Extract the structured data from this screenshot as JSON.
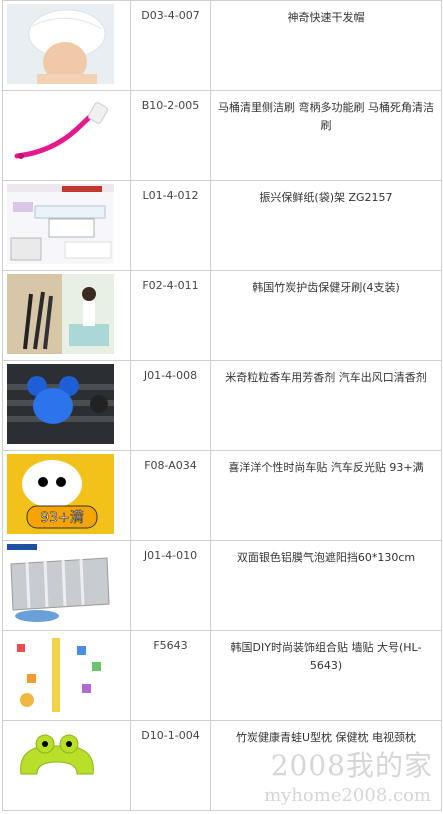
{
  "rows": [
    {
      "code": "D03-4-007",
      "name": "神奇快速干发帽",
      "image": "towel-cap-photo"
    },
    {
      "code": "B10-2-005",
      "name": "马桶清里侧洁刷 弯柄多功能刷 马桶死角清洁刷",
      "image": "toilet-brush-photo"
    },
    {
      "code": "L01-4-012",
      "name": "振兴保鲜纸(袋)架 ZG2157",
      "image": "wrap-holder-photo"
    },
    {
      "code": "F02-4-011",
      "name": "韩国竹炭护齿保健牙刷(4支装)",
      "image": "toothbrush-photo"
    },
    {
      "code": "J01-4-008",
      "name": "米奇粒粒香车用芳香剂 汽车出风口清香剂",
      "image": "air-freshener-photo"
    },
    {
      "code": "F08-A034",
      "name": "喜洋洋个性时尚车贴 汽车反光贴 93+满",
      "image": "car-sticker-photo",
      "sticker_text": "93+满"
    },
    {
      "code": "J01-4-010",
      "name": "双面银色铝膜气泡遮阳挡60*130cm",
      "image": "sunshade-photo"
    },
    {
      "code": "F5643",
      "name": "韩国DIY时尚装饰组合贴 墙贴 大号(HL-5643)",
      "image": "wall-sticker-photo"
    },
    {
      "code": "D10-1-004",
      "name": "竹炭健康青蛙U型枕 保健枕 电视颈枕",
      "image": "frog-pillow-photo"
    }
  ],
  "watermark": {
    "line1": "2008我的家",
    "line2": "myhome2008.com"
  },
  "colors": {
    "border": "#cfcfcf",
    "text": "#333333",
    "pink": "#e6198c",
    "lime": "#b8e02a"
  }
}
